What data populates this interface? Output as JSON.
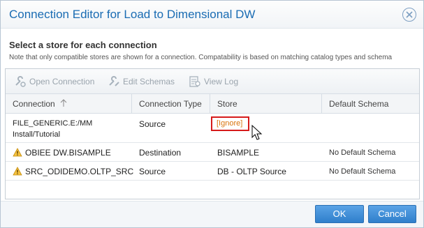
{
  "dialog": {
    "title": "Connection Editor for Load to Dimensional DW",
    "heading": "Select a store for each connection",
    "note": "Note that only compatible stores are shown for a connection. Compatability is based on matching catalog types and schema"
  },
  "toolbar": {
    "open_connection": "Open Connection",
    "edit_schemas": "Edit Schemas",
    "view_log": "View Log"
  },
  "grid": {
    "columns": [
      "Connection",
      "Connection Type",
      "Store",
      "Default Schema"
    ],
    "rows": [
      {
        "connection_line1": "FILE_GENERIC.E:/MM",
        "connection_line2": "Install/Tutorial",
        "warning": false,
        "type": "Source",
        "store": "[Ignore]",
        "schema": ""
      },
      {
        "connection": "OBIEE DW.BISAMPLE",
        "warning": true,
        "type": "Destination",
        "store": "BISAMPLE",
        "schema": "No Default Schema"
      },
      {
        "connection": "SRC_ODIDEMO.OLTP_SRC",
        "warning": true,
        "type": "Source",
        "store": "DB - OLTP Source",
        "schema": "No Default Schema"
      }
    ]
  },
  "footer": {
    "ok": "OK",
    "cancel": "Cancel"
  },
  "colors": {
    "accent": "#1a6cb3",
    "highlight": "#d61a1a",
    "ignore_text": "#d9730d"
  }
}
